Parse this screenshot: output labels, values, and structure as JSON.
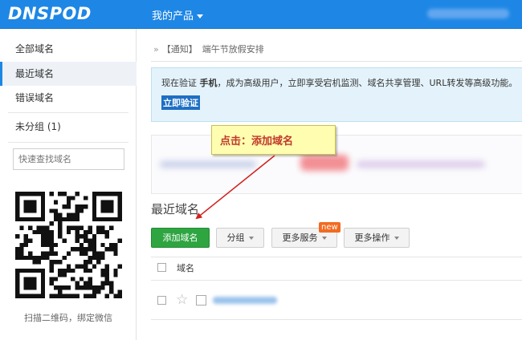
{
  "header": {
    "logo": "DNSPOD",
    "product_menu": "我的产品"
  },
  "sidebar": {
    "items": [
      {
        "label": "全部域名"
      },
      {
        "label": "最近域名"
      },
      {
        "label": "错误域名"
      },
      {
        "label": "未分组 (1)"
      }
    ],
    "search_placeholder": "快速查找域名",
    "qr_caption": "扫描二维码，绑定微信"
  },
  "notice": {
    "raquo": "»",
    "tag": "【通知】",
    "text": "端午节放假安排"
  },
  "verify": {
    "prefix": "现在验证",
    "highlight": "手机",
    "suffix": "，成为高级用户，立即享受宕机监测、域名共享管理、URL转发等高级功能。",
    "link": "立即验证"
  },
  "callout": {
    "text": "点击：添加域名"
  },
  "section": {
    "title": "最近域名"
  },
  "toolbar": {
    "add_domain": "添加域名",
    "group": "分组",
    "more_services": "更多服务",
    "new_badge": "new",
    "more_actions": "更多操作"
  },
  "table": {
    "column_domain": "域名"
  },
  "colors": {
    "header_blue": "#1e87e5",
    "primary_green": "#2ea541",
    "callout_yellow": "#fffdb0",
    "arrow_red": "#d0211c",
    "badge_orange": "#f26b22"
  },
  "icons": [
    "caret-down-icon",
    "qr-code",
    "star-icon",
    "checkbox"
  ]
}
